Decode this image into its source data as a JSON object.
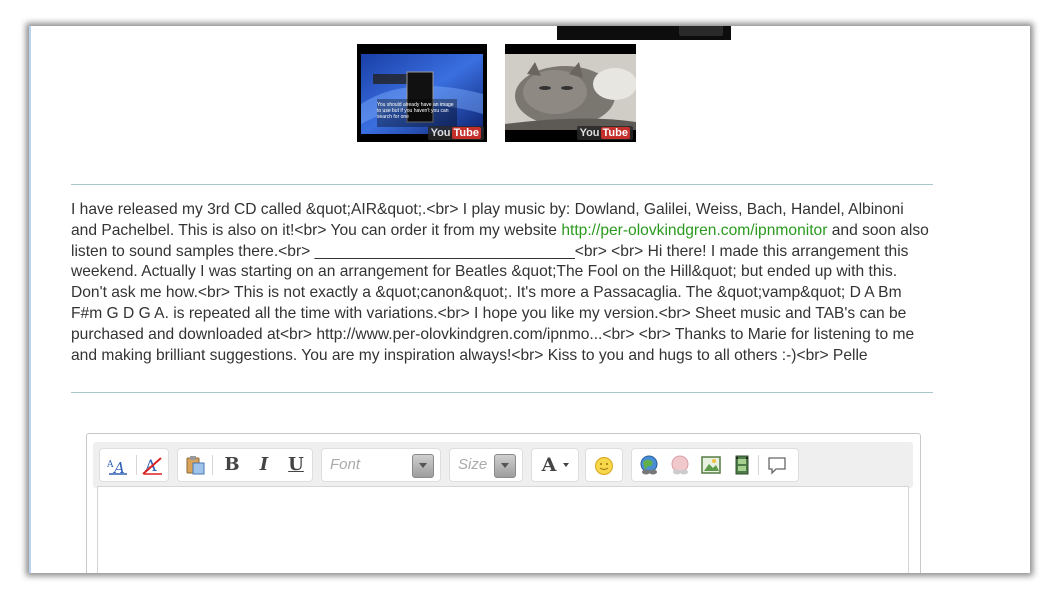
{
  "videos": [
    {
      "name": "video-thumbnail-top",
      "badge": ""
    },
    {
      "name": "video-thumbnail-1",
      "caption": "You should already have an image to use but if you haven't you can search for one",
      "badge_you": "You",
      "badge_tube": "Tube"
    },
    {
      "name": "video-thumbnail-2",
      "badge_you": "You",
      "badge_tube": "Tube"
    }
  ],
  "description": {
    "part1": "I have released my 3rd CD called &quot;AIR&quot;.<br> I play music by: Dowland, Galilei, Weiss, Bach, Handel, Albinoni and Pachelbel. This is also on it!<br> You can order it from my website ",
    "link": "http://per-olovkindgren.com/ipnmonitor",
    "part2": " and soon also listen to sound samples there.<br> ______________________________<br> <br> Hi there! I made this arrangement this weekend. Actually I was starting on an arrangement for Beatles &quot;The Fool on the Hill&quot; but ended up with this. Don't ask me how.<br> This is not exactly a &quot;canon&quot;. It's more a Passacaglia. The &quot;vamp&quot; D A Bm F#m G D G A. is repeated all the time with variations.<br> I hope you like my version.<br> Sheet music and TAB's can be purchased and downloaded at<br> http://www.per-olovkindgren.com/ipnmo...<br> <br> Thanks to Marie for listening to me and making brilliant suggestions. You are my inspiration always!<br> Kiss to you and hugs to all others :-)<br> Pelle"
  },
  "editor": {
    "font_placeholder": "Font",
    "size_placeholder": "Size",
    "bold": "B",
    "italic": "I",
    "underline": "U",
    "font_color": "A"
  },
  "colors": {
    "link": "#2a9a1e",
    "rule": "#a8c8cc",
    "frame_left": "#b9d3ee"
  }
}
